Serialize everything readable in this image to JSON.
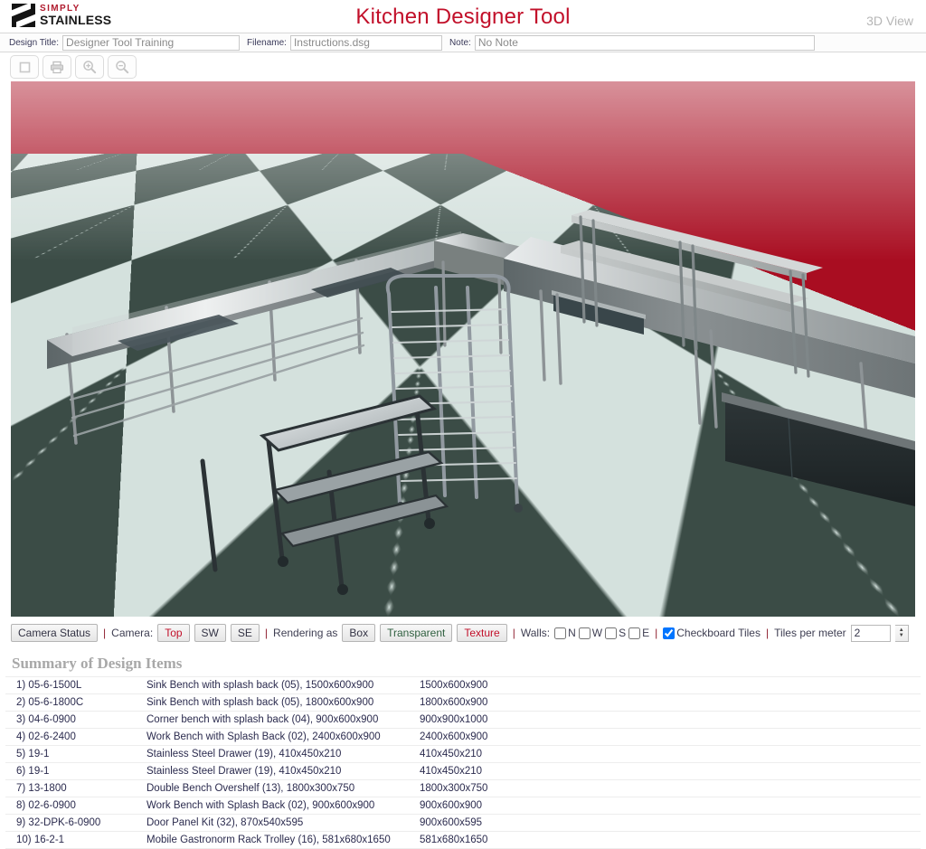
{
  "header": {
    "logo": {
      "line1": "SIMPLY",
      "line2": "STAINLESS",
      "alt": "simply-stainless-logo"
    },
    "app_title": "Kitchen Designer Tool",
    "view_mode": "3D View",
    "brand_red": "#c2102a"
  },
  "meta": {
    "design_title_label": "Design Title:",
    "design_title_value": "Designer Tool Training",
    "filename_label": "Filename:",
    "filename_value": "Instructions.dsg",
    "note_label": "Note:",
    "note_value": "No Note"
  },
  "toolbar": {
    "buttons": [
      {
        "name": "new-document-button",
        "icon": "document-icon",
        "label": "New"
      },
      {
        "name": "print-button",
        "icon": "printer-icon",
        "label": "Print"
      },
      {
        "name": "zoom-in-button",
        "icon": "zoom-in-icon",
        "label": "Zoom In"
      },
      {
        "name": "zoom-out-button",
        "icon": "zoom-out-icon",
        "label": "Zoom Out"
      }
    ]
  },
  "viewport": {
    "background_color": "#a90d21",
    "tile_dark": "#3b4c46",
    "tile_light": "#d4e1dd",
    "metal_color": "#9aa0a0"
  },
  "controls": {
    "camera_status_label": "Camera Status",
    "sep1": "|",
    "camera_label": "Camera:",
    "camera_options": [
      "Top",
      "SW",
      "SE"
    ],
    "camera_selected": "Top",
    "sep2": "|",
    "rendering_label": "Rendering as",
    "rendering_options": [
      "Box",
      "Transparent",
      "Texture"
    ],
    "rendering_selected": "Texture",
    "sep3": "|",
    "walls_label": "Walls:",
    "walls": [
      {
        "label": "N",
        "checked": false
      },
      {
        "label": "W",
        "checked": false
      },
      {
        "label": "S",
        "checked": false
      },
      {
        "label": "E",
        "checked": false
      }
    ],
    "sep4": "|",
    "checkerboard_label": "Checkboard Tiles",
    "checkerboard_checked": true,
    "sep5": "|",
    "tiles_per_meter_label": "Tiles per meter",
    "tiles_per_meter_value": "2"
  },
  "summary": {
    "title": "Summary of Design Items",
    "rows": [
      {
        "code": "1) 05-6-1500L",
        "desc": "Sink Bench with splash back (05), 1500x600x900",
        "dims": "1500x600x900"
      },
      {
        "code": "2) 05-6-1800C",
        "desc": "Sink Bench with splash back (05), 1800x600x900",
        "dims": "1800x600x900"
      },
      {
        "code": "3) 04-6-0900",
        "desc": "Corner bench with splash back (04), 900x600x900",
        "dims": "900x900x1000"
      },
      {
        "code": "4) 02-6-2400",
        "desc": "Work Bench with Splash Back (02), 2400x600x900",
        "dims": "2400x600x900"
      },
      {
        "code": "5) 19-1",
        "desc": "Stainless Steel Drawer (19), 410x450x210",
        "dims": "410x450x210"
      },
      {
        "code": "6) 19-1",
        "desc": "Stainless Steel Drawer (19), 410x450x210",
        "dims": "410x450x210"
      },
      {
        "code": "7) 13-1800",
        "desc": "Double Bench Overshelf (13), 1800x300x750",
        "dims": "1800x300x750"
      },
      {
        "code": "8) 02-6-0900",
        "desc": "Work Bench with Splash Back (02), 900x600x900",
        "dims": "900x600x900"
      },
      {
        "code": "9) 32-DPK-6-0900",
        "desc": "Door Panel Kit (32), 870x540x595",
        "dims": "900x600x595"
      },
      {
        "code": "10) 16-2-1",
        "desc": "Mobile Gastronorm Rack Trolley (16), 581x680x1650",
        "dims": "581x680x1650"
      }
    ]
  }
}
